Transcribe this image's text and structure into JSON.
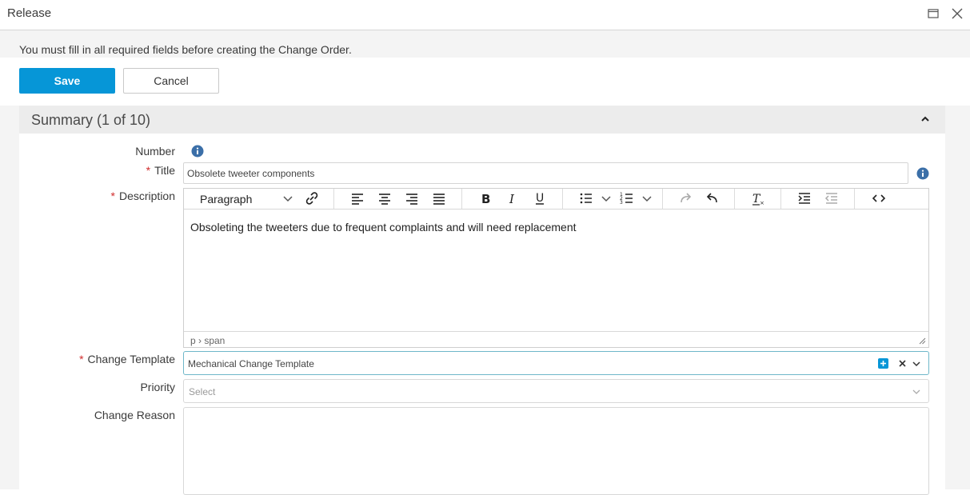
{
  "window": {
    "title": "Release",
    "maximize_icon": "maximize-icon",
    "close_icon": "close-icon"
  },
  "notice": {
    "message": "You must fill in all required fields before creating the Change Order."
  },
  "actions": {
    "save_label": "Save",
    "cancel_label": "Cancel"
  },
  "section": {
    "title": "Summary (1 of 10)",
    "collapse_icon": "chevron-up-icon"
  },
  "form": {
    "number_label": "Number",
    "title_label": "Title",
    "title_value": "Obsolete tweeter components",
    "description_label": "Description",
    "editor": {
      "format_select": "Paragraph",
      "content": "Obsoleting the tweeters due to frequent complaints and will need replacement",
      "path": "p › span"
    },
    "change_template_label": "Change Template",
    "change_template_value": "Mechanical Change Template",
    "priority_label": "Priority",
    "priority_placeholder": "Select",
    "change_reason_label": "Change Reason",
    "required_marker": "*"
  },
  "colors": {
    "primary": "#0696d7",
    "required": "#d02c2c",
    "info": "#3b6fa8",
    "focus_border": "#6fb7c9"
  }
}
